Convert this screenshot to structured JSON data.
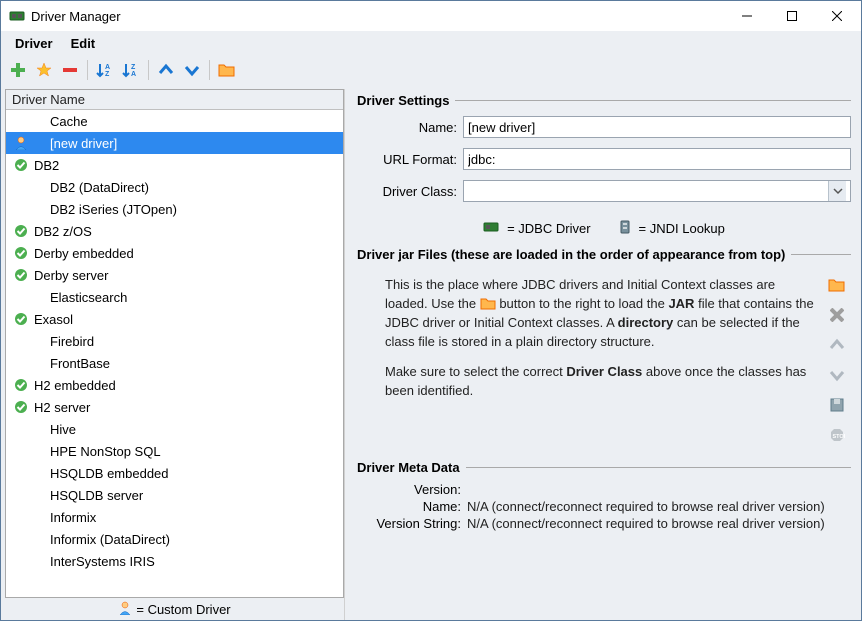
{
  "window": {
    "title": "Driver Manager"
  },
  "menu": {
    "driver": "Driver",
    "edit": "Edit"
  },
  "list": {
    "header": "Driver Name",
    "rows": [
      {
        "label": "Cache",
        "status": "none",
        "indent": true
      },
      {
        "label": "[new driver]",
        "status": "custom",
        "indent": true,
        "selected": true
      },
      {
        "label": "DB2",
        "status": "ok"
      },
      {
        "label": "DB2 (DataDirect)",
        "status": "none",
        "indent": true
      },
      {
        "label": "DB2 iSeries (JTOpen)",
        "status": "none",
        "indent": true
      },
      {
        "label": "DB2 z/OS",
        "status": "ok"
      },
      {
        "label": "Derby embedded",
        "status": "ok"
      },
      {
        "label": "Derby server",
        "status": "ok"
      },
      {
        "label": "Elasticsearch",
        "status": "none",
        "indent": true
      },
      {
        "label": "Exasol",
        "status": "ok"
      },
      {
        "label": "Firebird",
        "status": "none",
        "indent": true
      },
      {
        "label": "FrontBase",
        "status": "none",
        "indent": true
      },
      {
        "label": "H2 embedded",
        "status": "ok"
      },
      {
        "label": "H2 server",
        "status": "ok"
      },
      {
        "label": "Hive",
        "status": "none",
        "indent": true
      },
      {
        "label": "HPE NonStop SQL",
        "status": "none",
        "indent": true
      },
      {
        "label": "HSQLDB embedded",
        "status": "none",
        "indent": true
      },
      {
        "label": "HSQLDB server",
        "status": "none",
        "indent": true
      },
      {
        "label": "Informix",
        "status": "none",
        "indent": true
      },
      {
        "label": "Informix (DataDirect)",
        "status": "none",
        "indent": true
      },
      {
        "label": "InterSystems IRIS",
        "status": "none",
        "indent": true
      }
    ]
  },
  "legend": {
    "custom_driver": "= Custom Driver",
    "jdbc": "= JDBC Driver",
    "jndi": "= JNDI Lookup"
  },
  "settings": {
    "title": "Driver Settings",
    "name_label": "Name:",
    "name_value": "[new driver]",
    "url_label": "URL Format:",
    "url_value": "jdbc:",
    "class_label": "Driver Class:",
    "class_value": ""
  },
  "jar": {
    "title": "Driver jar Files (these are loaded in the order of appearance from top)",
    "p1a": "This is the place where JDBC drivers and Initial Context classes are loaded. Use the ",
    "p1b": " button to the right to load the ",
    "p1_jar": "JAR",
    "p1c": " file that contains the JDBC driver or Initial Context classes. A ",
    "p1_dir": "directory",
    "p1d": " can be selected if the class file is stored in a plain directory structure.",
    "p2a": "Make sure to select the correct ",
    "p2_dc": "Driver Class",
    "p2b": " above once the classes has been identified."
  },
  "meta": {
    "title": "Driver Meta Data",
    "version_label": "Version:",
    "version_value": "",
    "name_label": "Name:",
    "name_value": "N/A   (connect/reconnect required to browse real driver version)",
    "vstring_label": "Version String:",
    "vstring_value": "N/A   (connect/reconnect required to browse real driver version)"
  }
}
